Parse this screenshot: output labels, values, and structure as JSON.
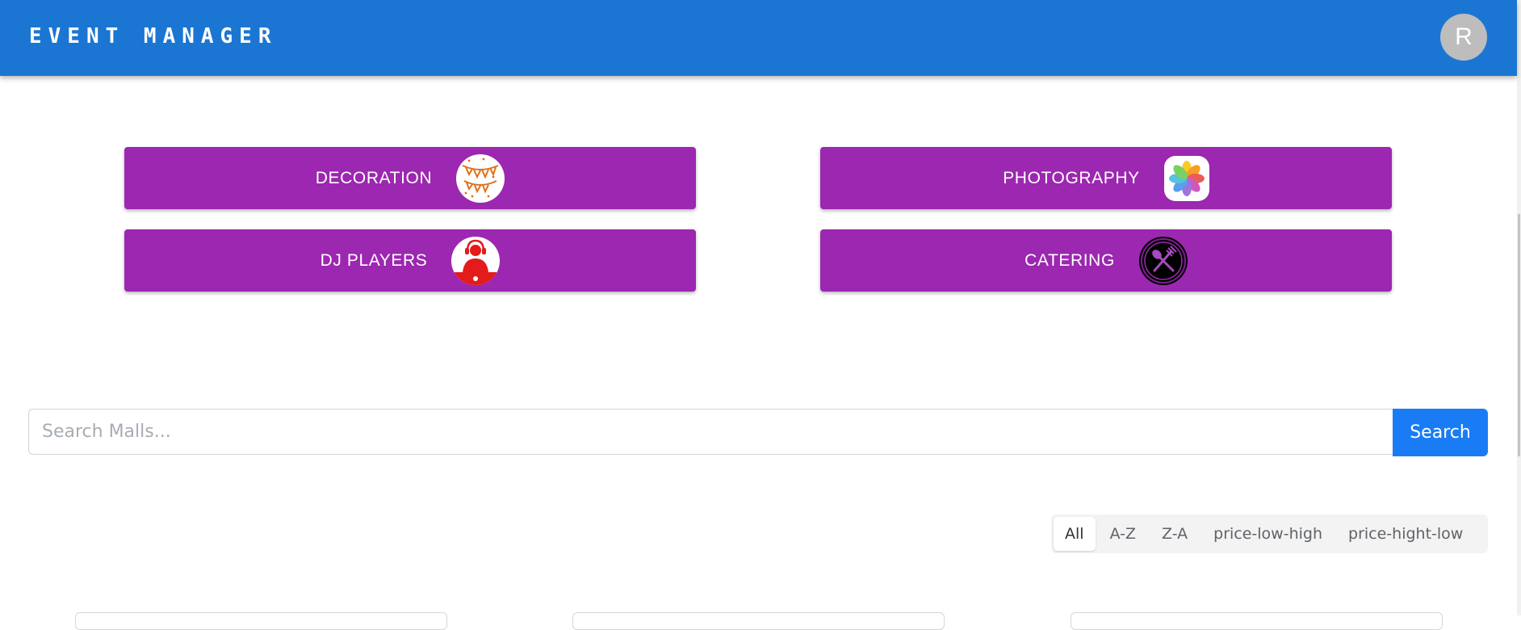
{
  "header": {
    "title": "EVENT MANAGER",
    "avatar_initial": "R"
  },
  "categories": [
    {
      "label": "DECORATION",
      "icon": "bunting-icon"
    },
    {
      "label": "PHOTOGRAPHY",
      "icon": "photos-icon"
    },
    {
      "label": "DJ PLAYERS",
      "icon": "dj-icon"
    },
    {
      "label": "CATERING",
      "icon": "fork-spoon-icon"
    }
  ],
  "search": {
    "placeholder": "Search Malls...",
    "button_label": "Search"
  },
  "sort": {
    "options": [
      "All",
      "A-Z",
      "Z-A",
      "price-low-high",
      "price-hight-low"
    ],
    "selected": "All"
  },
  "colors": {
    "appbar": "#1b76d3",
    "category_button": "#9c27b0",
    "search_button": "#1a7cf5"
  }
}
